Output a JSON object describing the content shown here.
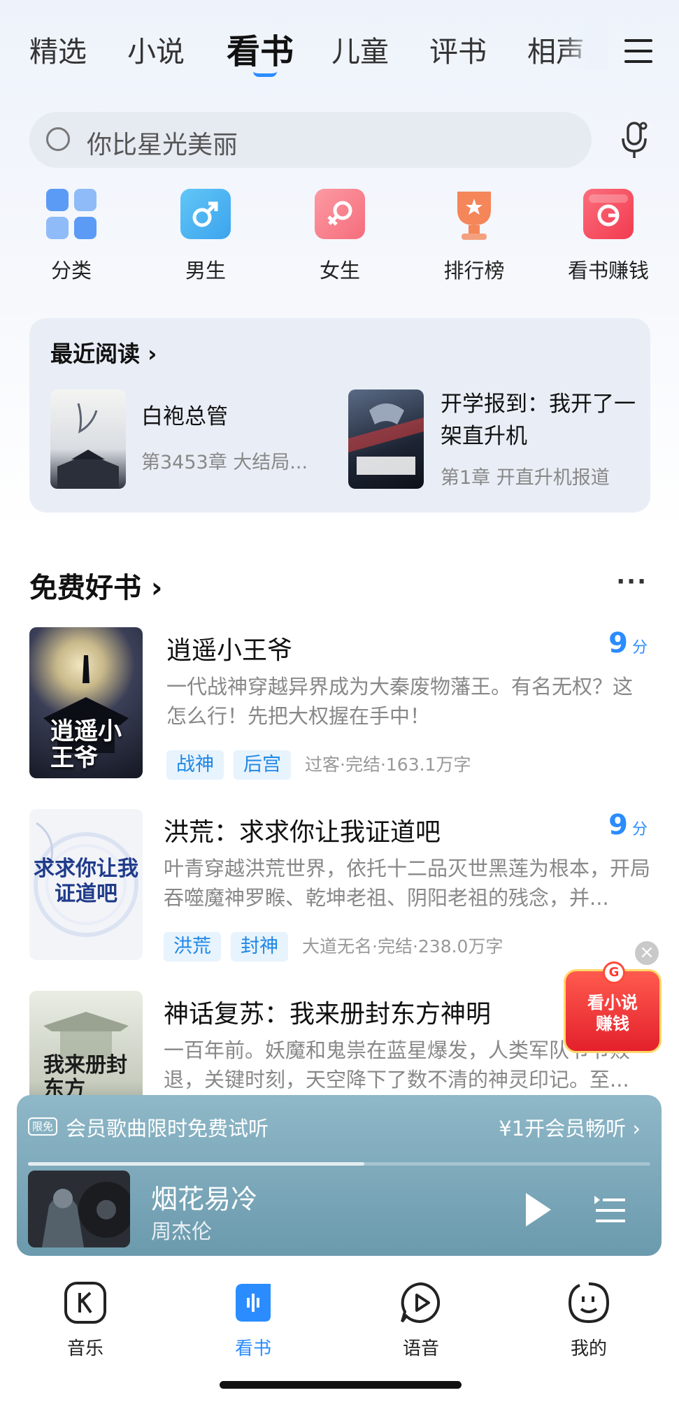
{
  "tabs": {
    "items": [
      "精选",
      "小说",
      "看书",
      "儿童",
      "评书",
      "相声"
    ],
    "active_index": 2
  },
  "search": {
    "placeholder": "你比星光美丽"
  },
  "categories": [
    {
      "label": "分类",
      "icon": "grid-icon",
      "color": "#5b9bf5"
    },
    {
      "label": "男生",
      "icon": "male-icon",
      "color": "#4fb6f2"
    },
    {
      "label": "女生",
      "icon": "female-icon",
      "color": "#f77a86"
    },
    {
      "label": "排行榜",
      "icon": "trophy-icon",
      "color": "#f4865a"
    },
    {
      "label": "看书赚钱",
      "icon": "coin-icon",
      "color": "#f7485a"
    }
  ],
  "recent": {
    "title": "最近阅读 ›",
    "books": [
      {
        "title": "白袍总管",
        "progress": "第3453章 大结局..."
      },
      {
        "title": "开学报到：我开了一架直升机",
        "progress": "第1章 开直升机报道"
      }
    ]
  },
  "free_books": {
    "title": "免费好书 ›",
    "more": "···",
    "items": [
      {
        "title": "逍遥小王爷",
        "score": "9",
        "score_unit": "分",
        "desc": "一代战神穿越异界成为大秦废物藩王。有名无权？这怎么行！先把大权握在手中！",
        "tags": [
          "战神",
          "后宫"
        ],
        "meta": "过客·完结·163.1万字",
        "cover_text": "逍遥小王爷"
      },
      {
        "title": "洪荒：求求你让我证道吧",
        "score": "9",
        "score_unit": "分",
        "desc": "叶青穿越洪荒世界，依托十二品灭世黑莲为根本，开局吞噬魔神罗睺、乾坤老祖、阴阳老祖的残念，并...",
        "tags": [
          "洪荒",
          "封神"
        ],
        "meta": "大道无名·完结·238.0万字",
        "cover_text": "求求你让我证道吧"
      },
      {
        "title": "神话复苏：我来册封东方神明",
        "desc": "一百年前。妖魔和鬼祟在蓝星爆发，人类军队节节败退，关键时刻，天空降下了数不清的神灵印记。至...",
        "cover_text": "我来册封东方"
      }
    ]
  },
  "red_packet": {
    "text_line1": "看小说",
    "text_line2": "赚钱",
    "coin": "G",
    "close": "×"
  },
  "player": {
    "promo_badge": "限免",
    "promo_text": "会员歌曲限时免费试听",
    "promo_cta": "¥1开会员畅听 ›",
    "progress": 0.54,
    "song": "烟花易冷",
    "artist": "周杰伦"
  },
  "bottom_nav": [
    {
      "label": "音乐",
      "icon": "music-k-icon",
      "active": false
    },
    {
      "label": "看书",
      "icon": "book-wave-icon",
      "active": true
    },
    {
      "label": "语音",
      "icon": "voice-play-icon",
      "active": false
    },
    {
      "label": "我的",
      "icon": "profile-face-icon",
      "active": false
    }
  ],
  "colors": {
    "accent": "#2a8cff",
    "tag_bg": "#e7f3fd",
    "tag_text": "#1f87e5"
  }
}
